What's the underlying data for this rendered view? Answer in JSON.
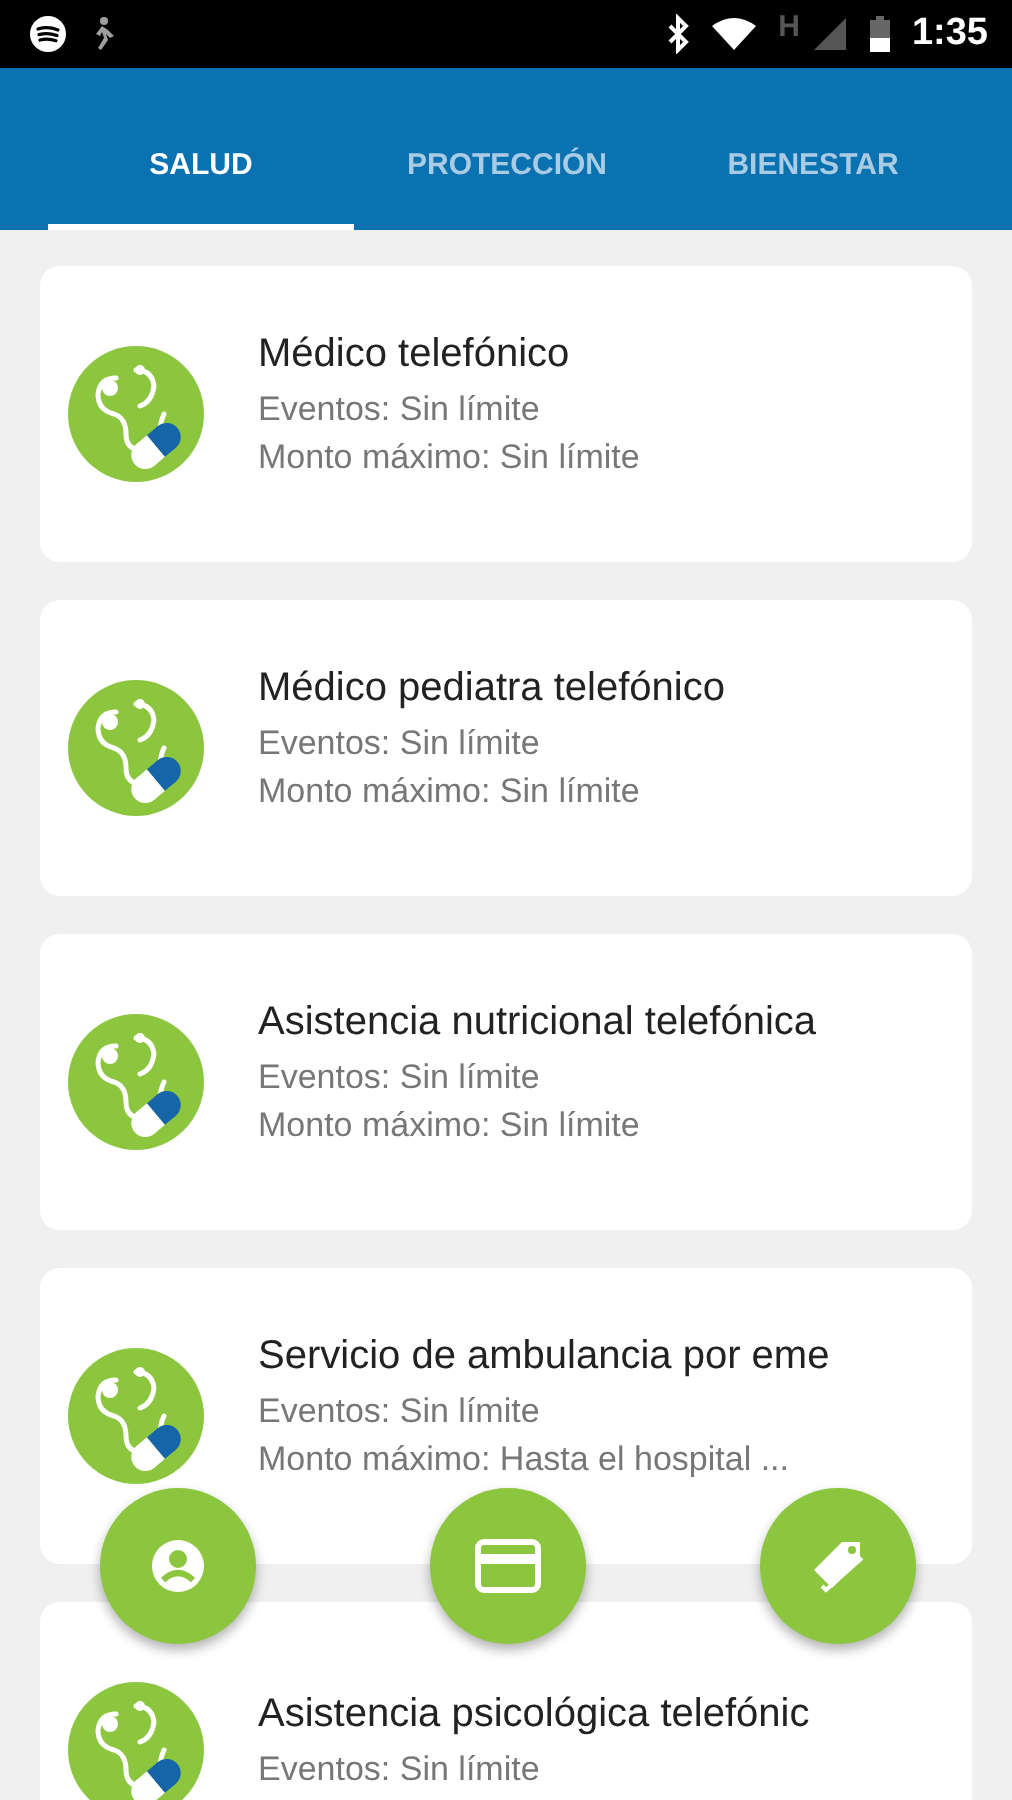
{
  "status_bar": {
    "network": "H",
    "time": "1:35"
  },
  "tabs": [
    {
      "label": "SALUD",
      "selected": true
    },
    {
      "label": "PROTECCIÓN",
      "selected": false
    },
    {
      "label": "BIENESTAR",
      "selected": false
    }
  ],
  "services": [
    {
      "title": "Médico telefónico",
      "events": "Eventos: Sin límite",
      "max_amount": "Monto máximo: Sin límite"
    },
    {
      "title": "Médico pediatra telefónico",
      "events": "Eventos: Sin límite",
      "max_amount": "Monto máximo: Sin límite"
    },
    {
      "title": "Asistencia nutricional telefónica",
      "events": "Eventos: Sin límite",
      "max_amount": "Monto máximo: Sin límite"
    },
    {
      "title": "Servicio de ambulancia por eme",
      "events": "Eventos: Sin límite",
      "max_amount": "Monto máximo: Hasta el hospital ..."
    },
    {
      "title": "Asistencia psicológica telefónic",
      "events": "Eventos: Sin límite"
    }
  ],
  "action_buttons": [
    {
      "kind": "profile"
    },
    {
      "kind": "card"
    },
    {
      "kind": "tag"
    }
  ]
}
